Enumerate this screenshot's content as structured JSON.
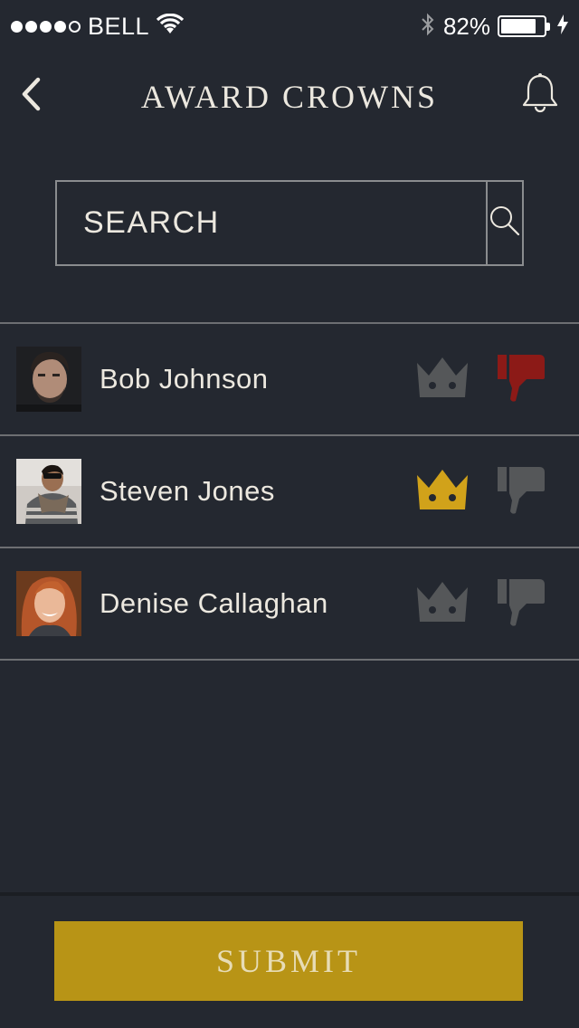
{
  "status_bar": {
    "carrier": "BELL",
    "battery_percent": "82%",
    "signal_bars_filled": 4,
    "signal_bars_total": 5,
    "battery_level": 0.82
  },
  "header": {
    "title": "AWARD CROWNS"
  },
  "search": {
    "placeholder": "SEARCH"
  },
  "users": [
    {
      "name": "Bob Johnson",
      "crown_active": false,
      "thumb_active": true
    },
    {
      "name": "Steven Jones",
      "crown_active": true,
      "thumb_active": false
    },
    {
      "name": "Denise Callaghan",
      "crown_active": false,
      "thumb_active": false
    }
  ],
  "footer": {
    "submit_label": "SUBMIT"
  },
  "colors": {
    "background": "#242830",
    "accent_gold": "#b89416",
    "crown_gold": "#d1a21a",
    "thumb_red": "#8c1a17",
    "inactive_icon": "#555759"
  },
  "icons": {
    "back": "chevron-left-icon",
    "notifications": "bell-icon",
    "search": "magnifier-icon",
    "crown": "crown-icon",
    "thumbs_down": "thumbs-down-icon"
  }
}
